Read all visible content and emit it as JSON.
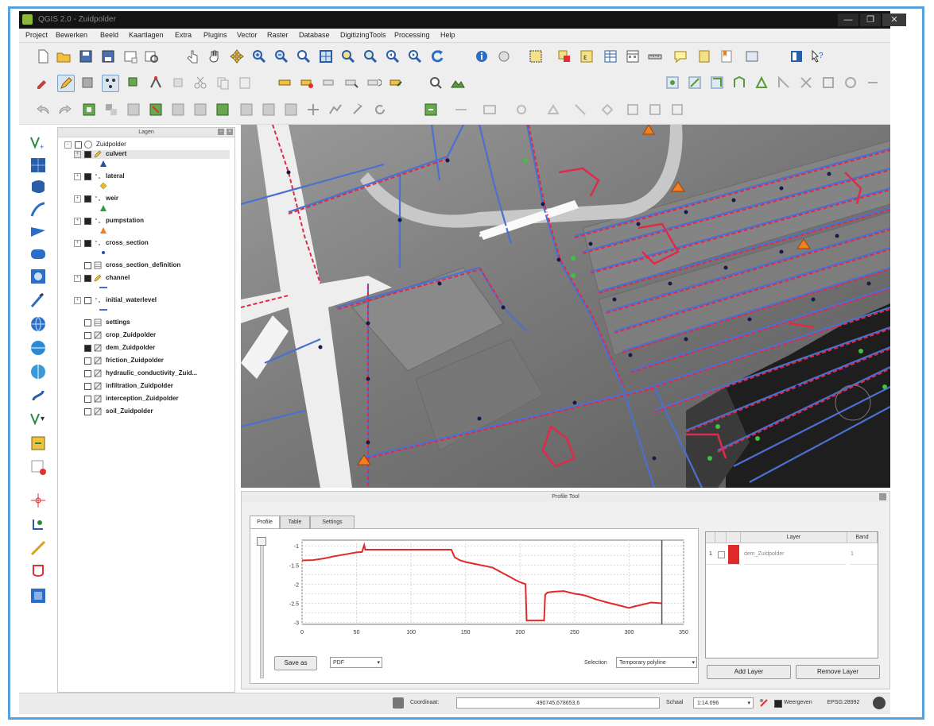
{
  "window": {
    "title": "QGIS 2.0 - Zuidpolder",
    "minimize": "—",
    "maximize": "❐",
    "close": "✕"
  },
  "menu": [
    "Project",
    "Bewerken",
    "Beeld",
    "Kaartlagen",
    "Extra",
    "Plugins",
    "Vector",
    "Raster",
    "Database",
    "DigitizingTools",
    "Processing",
    "Help"
  ],
  "legend": {
    "title": "Lagen",
    "group": "Zuidpolder",
    "layers": [
      {
        "name": "culvert",
        "checked": true,
        "icon": "pencil-icon",
        "symbol": "triangle-blue-icon",
        "selected": true
      },
      {
        "name": "lateral",
        "checked": true,
        "icon": "",
        "symbol": "diamond-yellow-icon"
      },
      {
        "name": "weir",
        "checked": true,
        "icon": "",
        "symbol": "triangle-green-icon"
      },
      {
        "name": "pumpstation",
        "checked": true,
        "icon": "",
        "symbol": "triangle-orange-icon"
      },
      {
        "name": "cross_section",
        "checked": true,
        "icon": "",
        "symbol": "dot-blue-icon"
      },
      {
        "name": "cross_section_definition",
        "checked": false,
        "icon": "table-icon",
        "symbol": ""
      },
      {
        "name": "channel",
        "checked": true,
        "icon": "pencil-icon",
        "symbol": "line-blue-icon"
      },
      {
        "name": "initial_waterlevel",
        "checked": false,
        "icon": "",
        "symbol": "line-blue-icon"
      },
      {
        "name": "settings",
        "checked": false,
        "icon": "table-icon",
        "symbol": ""
      },
      {
        "name": "crop_Zuidpolder",
        "checked": false,
        "icon": "raster-icon",
        "symbol": ""
      },
      {
        "name": "dem_Zuidpolder",
        "checked": true,
        "icon": "raster-icon",
        "symbol": ""
      },
      {
        "name": "friction_Zuidpolder",
        "checked": false,
        "icon": "raster-icon",
        "symbol": ""
      },
      {
        "name": "hydraulic_conductivity_Zuid...",
        "checked": false,
        "icon": "raster-icon",
        "symbol": ""
      },
      {
        "name": "infiltration_Zuidpolder",
        "checked": false,
        "icon": "raster-icon",
        "symbol": ""
      },
      {
        "name": "interception_Zuidpolder",
        "checked": false,
        "icon": "raster-icon",
        "symbol": ""
      },
      {
        "name": "soil_Zuidpolder",
        "checked": false,
        "icon": "raster-icon",
        "symbol": ""
      }
    ]
  },
  "profile_tool": {
    "title": "Profile Tool",
    "tabs": [
      "Profile",
      "Table",
      "Settings"
    ],
    "save_as": "Save as",
    "format": "PDF",
    "selection_label": "Selection",
    "selection_value": "Temporary polyline",
    "table_headers": [
      "Layer",
      "Band"
    ],
    "table_rows": [
      {
        "index": "1",
        "color": "#e02a2a",
        "layer": "dem_Zuidpolder",
        "band": "1"
      }
    ],
    "add_layer": "Add Layer",
    "remove_layer": "Remove Layer"
  },
  "chart_data": {
    "type": "line",
    "xlim": [
      0,
      350
    ],
    "ylim": [
      -3.05,
      -0.85
    ],
    "xticks": [
      "0",
      "50",
      "100",
      "150",
      "200",
      "250",
      "300",
      "350"
    ],
    "yticks": [
      "-1",
      "-1.5",
      "-2",
      "-2.5",
      "-3"
    ],
    "grid": true,
    "series": [
      {
        "color": "#e02a2a",
        "x": [
          0,
          10,
          20,
          30,
          40,
          50,
          55,
          57,
          58,
          60,
          80,
          100,
          120,
          130,
          137,
          140,
          145,
          150,
          160,
          170,
          175,
          180,
          190,
          195,
          200,
          205,
          206,
          210,
          215,
          220,
          222,
          223,
          225,
          230,
          240,
          250,
          255,
          260,
          270,
          280,
          290,
          300,
          305,
          310,
          320,
          330
        ],
        "y": [
          -1.38,
          -1.37,
          -1.33,
          -1.27,
          -1.22,
          -1.17,
          -1.16,
          -0.98,
          -1.1,
          -1.1,
          -1.1,
          -1.1,
          -1.1,
          -1.1,
          -1.1,
          -1.3,
          -1.38,
          -1.42,
          -1.48,
          -1.54,
          -1.57,
          -1.65,
          -1.8,
          -1.88,
          -1.95,
          -2.0,
          -2.95,
          -2.95,
          -2.95,
          -2.95,
          -2.95,
          -2.28,
          -2.22,
          -2.2,
          -2.18,
          -2.25,
          -2.27,
          -2.3,
          -2.4,
          -2.48,
          -2.55,
          -2.62,
          -2.58,
          -2.55,
          -2.48,
          -2.5
        ]
      }
    ]
  },
  "status": {
    "coordinate_label": "Coordinaat:",
    "coordinate_value": "490745,678653,6",
    "scale_label": "Schaal",
    "scale_value": "1:14.096",
    "render_label": "Weergeven",
    "crs": "EPSG:28992"
  }
}
